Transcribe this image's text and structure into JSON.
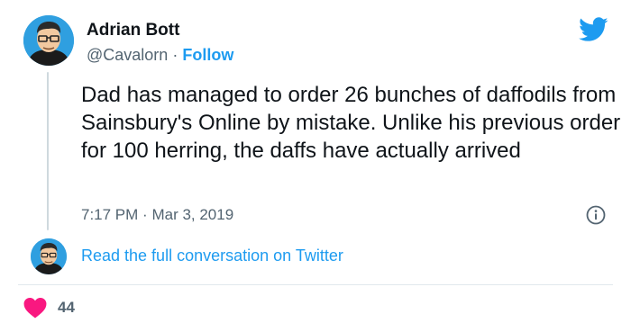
{
  "author": {
    "name": "Adrian Bott",
    "handle": "@Cavalorn",
    "separator": "·",
    "follow_label": "Follow"
  },
  "tweet": {
    "text": "Dad has managed to order 26 bunches of daffodils from Sainsbury's Online by mistake. Unlike his previous order for 100 herring, the daffs have actually arrived",
    "time": "7:17 PM",
    "meta_separator": "·",
    "date": "Mar 3, 2019"
  },
  "conversation": {
    "link_label": "Read the full conversation on Twitter"
  },
  "engagement": {
    "like_count": "44"
  },
  "icons": {
    "brand": "twitter-bird-icon",
    "info": "info-icon",
    "like": "heart-icon"
  },
  "colors": {
    "accent": "#1d9bf0",
    "heart": "#f91880",
    "muted": "#536471",
    "text": "#0f1419"
  }
}
